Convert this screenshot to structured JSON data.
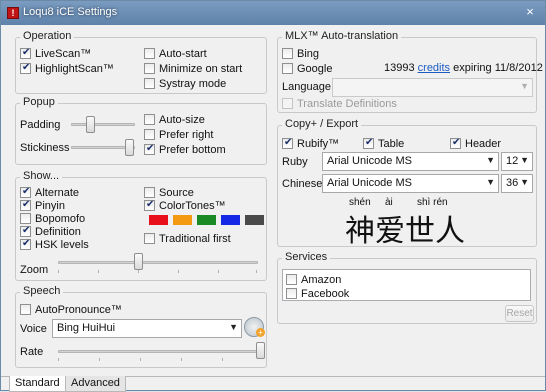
{
  "window": {
    "title": "Loqu8 iCE Settings",
    "close_glyph": "×"
  },
  "operation": {
    "legend": "Operation",
    "livescan": {
      "label": "LiveScan™",
      "checked": true
    },
    "highlightscan": {
      "label": "HighlightScan™",
      "checked": true
    },
    "autostart": {
      "label": "Auto-start",
      "checked": false
    },
    "minimize": {
      "label": "Minimize on start",
      "checked": false
    },
    "systray": {
      "label": "Systray mode",
      "checked": false
    }
  },
  "popup": {
    "legend": "Popup",
    "padding_label": "Padding",
    "stickiness_label": "Stickiness",
    "autosize": {
      "label": "Auto-size",
      "checked": false
    },
    "prefer_right": {
      "label": "Prefer right",
      "checked": false
    },
    "prefer_bottom": {
      "label": "Prefer bottom",
      "checked": true
    }
  },
  "show": {
    "legend": "Show...",
    "alternate": {
      "label": "Alternate",
      "checked": true
    },
    "pinyin": {
      "label": "Pinyin",
      "checked": true
    },
    "bopomofo": {
      "label": "Bopomofo",
      "checked": false
    },
    "definition": {
      "label": "Definition",
      "checked": true
    },
    "hsk": {
      "label": "HSK levels",
      "checked": true
    },
    "source": {
      "label": "Source",
      "checked": false
    },
    "colortones": {
      "label": "ColorTones™",
      "checked": true
    },
    "traditional_first": {
      "label": "Traditional first",
      "checked": false
    },
    "tone_colors": [
      "#e8101a",
      "#f39a12",
      "#1a8a24",
      "#1428e6",
      "#4a4a4a"
    ],
    "zoom_label": "Zoom"
  },
  "speech": {
    "legend": "Speech",
    "autopronounce": {
      "label": "AutoPronounce™",
      "checked": false
    },
    "voice_label": "Voice",
    "voice_value": "Bing HuiHui",
    "rate_label": "Rate"
  },
  "mlx": {
    "legend": "MLX™ Auto-translation",
    "bing": {
      "label": "Bing",
      "checked": false
    },
    "google": {
      "label": "Google",
      "checked": false
    },
    "credits_count": "13993",
    "credits_link": "credits",
    "credits_expiry": "expiring 11/8/2012",
    "language_label": "Language",
    "language_value": "",
    "translate_definitions": {
      "label": "Translate Definitions",
      "checked": false
    }
  },
  "copy_export": {
    "legend": "Copy+ / Export",
    "rubify": {
      "label": "Rubify™",
      "checked": true
    },
    "table": {
      "label": "Table",
      "checked": true
    },
    "header": {
      "label": "Header",
      "checked": true
    },
    "ruby_label": "Ruby",
    "ruby_font": "Arial Unicode MS",
    "ruby_size": "12",
    "chinese_label": "Chinese",
    "chinese_font": "Arial Unicode MS",
    "chinese_size": "36",
    "preview_pinyin": [
      "shén",
      "ài",
      "shì rén"
    ],
    "preview_hanzi": "神爱世人"
  },
  "services": {
    "legend": "Services",
    "items": [
      {
        "label": "Amazon",
        "checked": false
      },
      {
        "label": "Facebook",
        "checked": false
      }
    ],
    "reset_label": "Reset"
  },
  "tabs": [
    {
      "label": "Standard",
      "active": true
    },
    {
      "label": "Advanced",
      "active": false
    }
  ]
}
